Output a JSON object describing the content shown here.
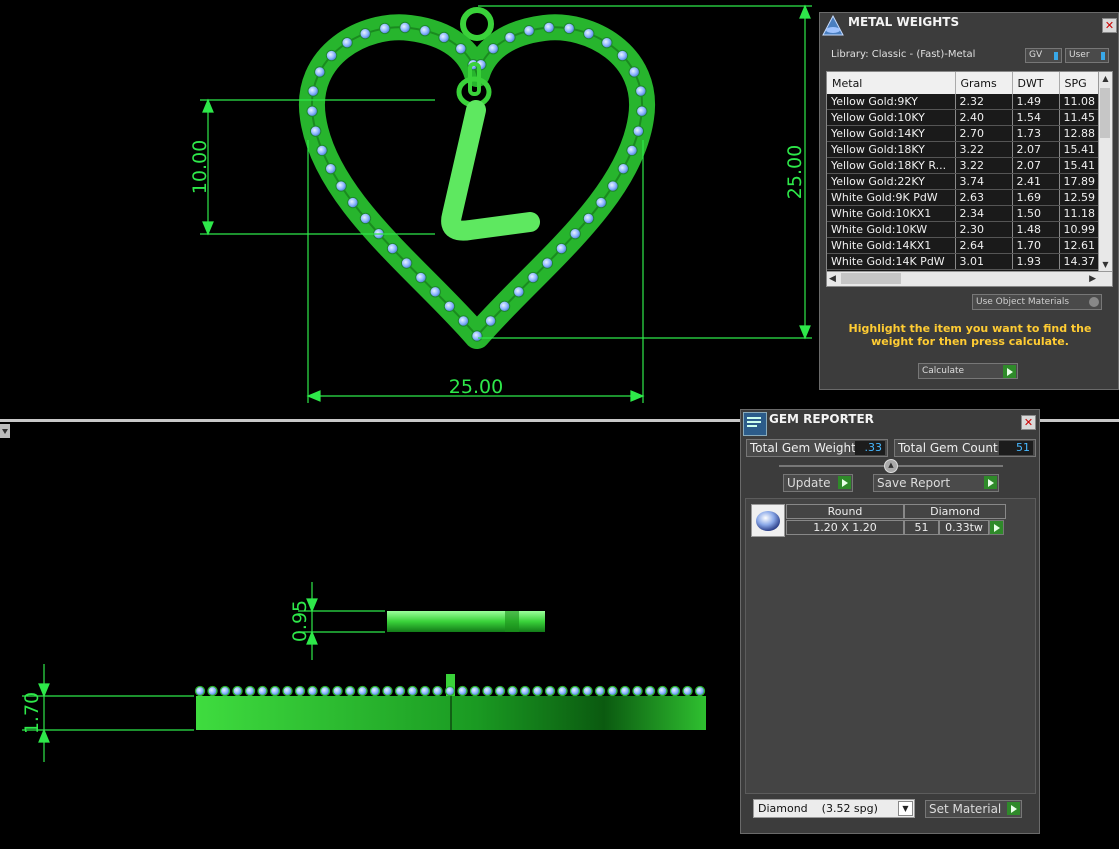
{
  "viewport": {
    "dims": {
      "top_height": "10.00",
      "top_right": "25.00",
      "top_width": "25.00",
      "thickness_small": "0.95",
      "thickness_side": "1.70"
    }
  },
  "metal_weights": {
    "title": "METAL WEIGHTS",
    "library": "Library: Classic - (Fast)-Metal",
    "gv_label": "GV",
    "user_label": "User",
    "columns": [
      "Metal",
      "Grams",
      "DWT",
      "SPG"
    ],
    "rows": [
      [
        "Yellow Gold:9KY",
        "2.32",
        "1.49",
        "11.08"
      ],
      [
        "Yellow Gold:10KY",
        "2.40",
        "1.54",
        "11.45"
      ],
      [
        "Yellow Gold:14KY",
        "2.70",
        "1.73",
        "12.88"
      ],
      [
        "Yellow Gold:18KY",
        "3.22",
        "2.07",
        "15.41"
      ],
      [
        "Yellow Gold:18KY R...",
        "3.22",
        "2.07",
        "15.41"
      ],
      [
        "Yellow Gold:22KY",
        "3.74",
        "2.41",
        "17.89"
      ],
      [
        "White Gold:9K PdW",
        "2.63",
        "1.69",
        "12.59"
      ],
      [
        "White Gold:10KX1",
        "2.34",
        "1.50",
        "11.18"
      ],
      [
        "White Gold:10KW",
        "2.30",
        "1.48",
        "10.99"
      ],
      [
        "White Gold:14KX1",
        "2.64",
        "1.70",
        "12.61"
      ],
      [
        "White Gold:14K PdW",
        "3.01",
        "1.93",
        "14.37"
      ]
    ],
    "use_object_materials": "Use Object Materials",
    "hint": "Highlight the item you want to find the weight for then press calculate.",
    "calculate": "Calculate"
  },
  "gem_reporter": {
    "title": "GEM REPORTER",
    "total_weight_label": "Total Gem Weight",
    "total_weight_value": ".33",
    "total_count_label": "Total Gem Count",
    "total_count_value": "51",
    "update": "Update",
    "save_report": "Save Report",
    "gem": {
      "shape": "Round",
      "material": "Diamond",
      "size": "1.20 X 1.20",
      "count": "51",
      "weight": "0.33tw"
    },
    "material_select": "Diamond    (3.52 spg)",
    "set_material": "Set Material"
  }
}
